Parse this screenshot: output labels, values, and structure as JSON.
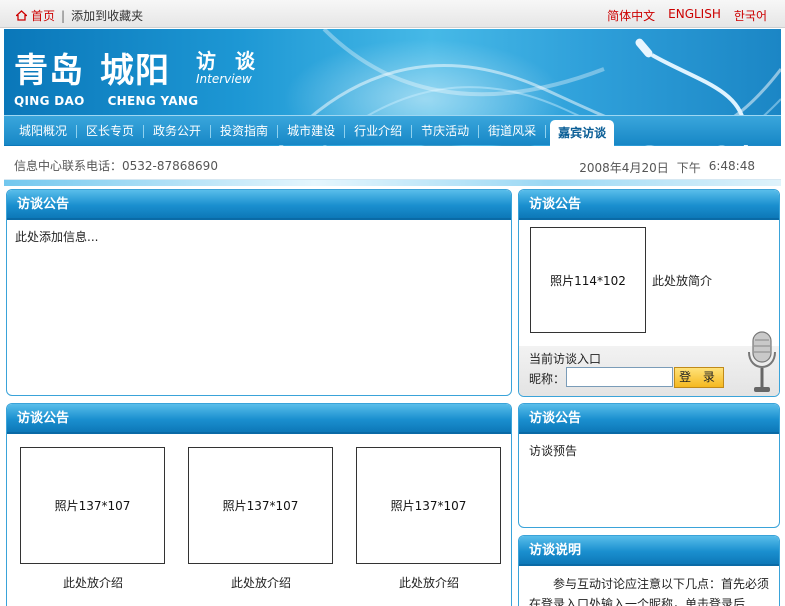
{
  "topbar": {
    "home": "首页",
    "bookmark": "添加到收藏夹",
    "languages": [
      "简体中文",
      "ENGLISH",
      "한국어"
    ]
  },
  "brand": {
    "title_part1": "青岛",
    "title_part2": "城阳",
    "subtitle": "访 谈",
    "subtitle_en": "Interview",
    "pinyin1": "QING DAO",
    "pinyin2": "CHENG YANG"
  },
  "nav": {
    "items": [
      "城阳概况",
      "区长专页",
      "政务公开",
      "投资指南",
      "城市建设",
      "行业介绍",
      "节庆活动",
      "街道风采",
      "嘉宾访谈"
    ],
    "active_index": 8
  },
  "info": {
    "hotline": "信息中心联系电话：0532-87868690",
    "date": "2008年4月20日",
    "period": "下午",
    "time": "6:48:48"
  },
  "panel1": {
    "title": "访谈公告",
    "text": "此处添加信息..."
  },
  "panel2": {
    "title": "访谈公告",
    "photo": "照片114*102",
    "intro": "此处放简介",
    "entry_label": "当前访谈入口",
    "nick_label": "昵称：",
    "nick_value": "",
    "login_label": "登 录"
  },
  "panel3": {
    "title": "访谈公告",
    "items": [
      {
        "photo": "照片137*107",
        "caption": "此处放介绍"
      },
      {
        "photo": "照片137*107",
        "caption": "此处放介绍"
      },
      {
        "photo": "照片137*107",
        "caption": "此处放介绍"
      }
    ]
  },
  "panel4": {
    "title": "访谈公告",
    "text": "访谈预告"
  },
  "panel5": {
    "title": "访谈说明",
    "text": "参与互动讨论应注意以下几点：首先必须在登录入口处输入一个昵称，单击登录后"
  },
  "colors": {
    "accent_red": "#cc0000",
    "panel_blue": "#1a8fcf",
    "banner_blue": "#1d97d4"
  }
}
